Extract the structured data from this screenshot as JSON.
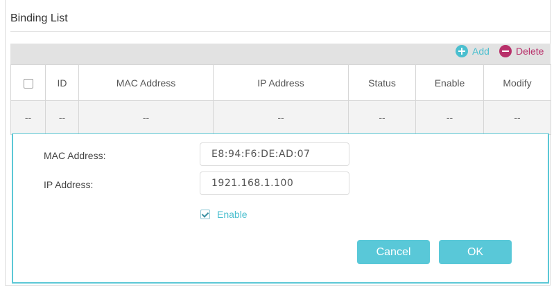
{
  "title": "Binding List",
  "toolbar": {
    "add_label": "Add",
    "delete_label": "Delete"
  },
  "table": {
    "headers": [
      "",
      "ID",
      "MAC Address",
      "IP Address",
      "Status",
      "Enable",
      "Modify"
    ],
    "rows": [
      [
        "--",
        "--",
        "--",
        "--",
        "--",
        "--",
        "--"
      ]
    ]
  },
  "form": {
    "mac_label": "MAC Address:",
    "mac_value": "E8:94:F6:DE:AD:07",
    "ip_label": "IP Address:",
    "ip_value": "1921.168.1.100",
    "enable_label": "Enable",
    "enable_checked": true,
    "cancel_label": "Cancel",
    "ok_label": "OK"
  },
  "colors": {
    "accent": "#59c8d8",
    "add": "#4bbfcf",
    "delete": "#b8306a"
  }
}
